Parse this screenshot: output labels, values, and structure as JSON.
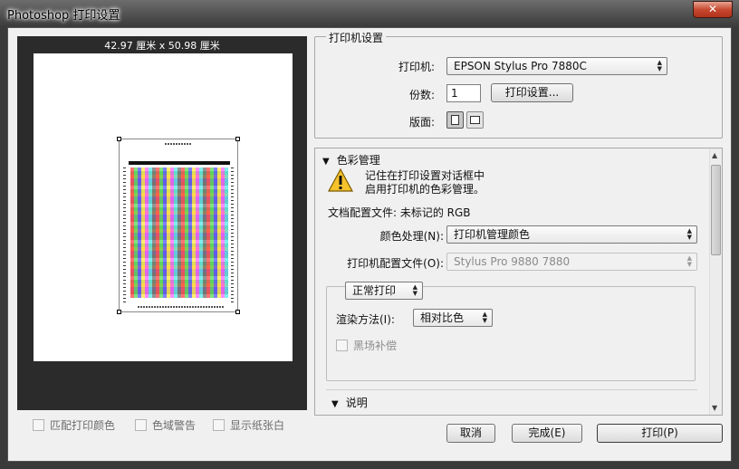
{
  "window": {
    "title": "Photoshop 打印设置",
    "close_glyph": "✕"
  },
  "preview": {
    "size_label": "42.97 厘米 x 50.98 厘米"
  },
  "bottom_checks": {
    "match_colors": "匹配打印颜色",
    "gamut_warning": "色域警告",
    "show_paper_white": "显示纸张白"
  },
  "printer_setup": {
    "group_title": "打印机设置",
    "printer_label": "打印机:",
    "printer_value": "EPSON Stylus Pro 7880C",
    "copies_label": "份数:",
    "copies_value": "1",
    "print_settings_button": "打印设置...",
    "layout_label": "版面:"
  },
  "color_management": {
    "section_title": "色彩管理",
    "note_line1": "记住在打印设置对话框中",
    "note_line2": "启用打印机的色彩管理。",
    "doc_profile": "文档配置文件: 未标记的 RGB",
    "color_handling_label": "颜色处理(N):",
    "color_handling_value": "打印机管理颜色",
    "printer_profile_label": "打印机配置文件(O):",
    "printer_profile_value": "Stylus Pro 9880 7880",
    "print_mode_value": "正常打印",
    "rendering_label": "渲染方法(I):",
    "rendering_value": "相对比色",
    "black_point_label": "黑场补偿"
  },
  "description": {
    "section_title": "说明"
  },
  "buttons": {
    "cancel": "取消",
    "done": "完成(E)",
    "print": "打印(P)"
  },
  "icons": {
    "warning": "warning-icon",
    "dropdown": "chevron-down-icon",
    "portrait": "portrait-layout-icon",
    "landscape": "landscape-layout-icon"
  }
}
